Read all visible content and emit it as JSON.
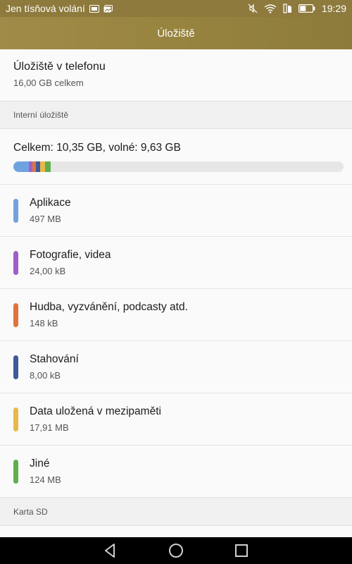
{
  "status_bar": {
    "carrier_text": "Jen tísňová volání",
    "time": "19:29",
    "icons": [
      "sim-icon",
      "image-notification-icon",
      "mute-icon",
      "wifi-icon",
      "sd-card-icon",
      "battery-icon"
    ]
  },
  "app_bar": {
    "title": "Úložiště"
  },
  "phone_storage": {
    "title": "Úložiště v telefonu",
    "subtitle": "16,00  GB celkem"
  },
  "internal": {
    "header": "Interní úložiště",
    "total_text": "Celkem: 10,35 GB, volné: 9,63 GB",
    "bar_colors": [
      "#6fa3e0",
      "#a05fc8",
      "#e0733d",
      "#3d5a99",
      "#e9b84a",
      "#5fae4e"
    ]
  },
  "items": [
    {
      "label": "Aplikace",
      "value": "497 MB",
      "color": "#6fa3e0"
    },
    {
      "label": "Fotografie, videa",
      "value": "24,00 kB",
      "color": "#a05fc8"
    },
    {
      "label": "Hudba, vyzvánění, podcasty atd.",
      "value": "148 kB",
      "color": "#e0733d"
    },
    {
      "label": "Stahování",
      "value": "8,00 kB",
      "color": "#3d5a99"
    },
    {
      "label": "Data uložená v mezipaměti",
      "value": "17,91 MB",
      "color": "#e9b84a"
    },
    {
      "label": "Jiné",
      "value": "124 MB",
      "color": "#5fae4e"
    }
  ],
  "sd_card": {
    "header": "Karta SD"
  },
  "nav_bar": {
    "icons": [
      "back-icon",
      "home-icon",
      "recents-icon"
    ]
  }
}
